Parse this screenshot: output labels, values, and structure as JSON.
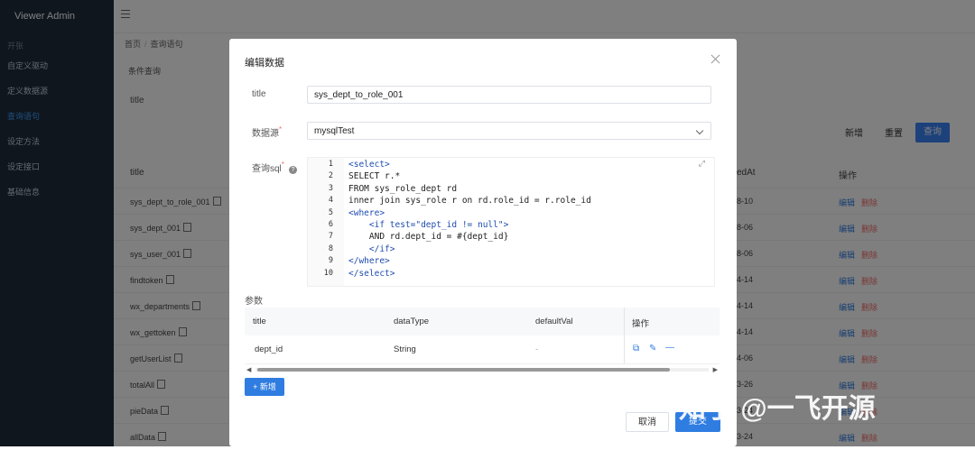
{
  "sidebar": {
    "brand": "Viewer Admin",
    "group_label": "开张",
    "items": [
      {
        "label": "自定义驱动"
      },
      {
        "label": "定义数据源"
      },
      {
        "label": "查询语句"
      },
      {
        "label": "设定方法"
      },
      {
        "label": "设定接口"
      },
      {
        "label": "基础信息"
      }
    ]
  },
  "breadcrumb": {
    "home": "首页",
    "sep": "/",
    "current": "查询语句"
  },
  "filter": {
    "section_label": "条件查询",
    "title_label": "title"
  },
  "toolbar": {
    "add": "新增",
    "reset": "重置",
    "query": "查询"
  },
  "table": {
    "headers": {
      "title": "title",
      "created": "edAt",
      "op": "操作"
    },
    "rows": [
      {
        "title": "sys_dept_to_role_001",
        "date": "8-10",
        "edit": "编辑",
        "del": "删除"
      },
      {
        "title": "sys_dept_001",
        "date": "8-06",
        "edit": "编辑",
        "del": "删除"
      },
      {
        "title": "sys_user_001",
        "date": "8-06",
        "edit": "编辑",
        "del": "删除"
      },
      {
        "title": "findtoken",
        "date": "4-14",
        "edit": "编辑",
        "del": "删除"
      },
      {
        "title": "wx_departments",
        "date": "4-14",
        "edit": "编辑",
        "del": "删除"
      },
      {
        "title": "wx_gettoken",
        "date": "4-14",
        "edit": "编辑",
        "del": "删除"
      },
      {
        "title": "getUserList",
        "date": "4-06",
        "edit": "编辑",
        "del": "删除"
      },
      {
        "title": "totalAll",
        "date": "3-26",
        "edit": "编辑",
        "del": "删除"
      },
      {
        "title": "pieData",
        "date": "3-24",
        "edit": "编辑",
        "del": "删除"
      },
      {
        "title": "allData",
        "date": "3-24",
        "edit": "编辑",
        "del": "删除"
      }
    ]
  },
  "modal": {
    "title": "编辑数据",
    "fields": {
      "title_label": "title",
      "title_value": "sys_dept_to_role_001",
      "datasource_label": "数据源",
      "datasource_value": "mysqlTest",
      "sql_label": "查询sql",
      "help": "?"
    },
    "sql_lines": [
      {
        "n": "1",
        "text": "<select>"
      },
      {
        "n": "2",
        "text": "SELECT r.*"
      },
      {
        "n": "3",
        "text": "FROM sys_role_dept rd"
      },
      {
        "n": "4",
        "text": "inner join sys_role r on rd.role_id = r.role_id"
      },
      {
        "n": "5",
        "text": "<where>"
      },
      {
        "n": "6",
        "text": "    <if test=\"dept_id != null\">"
      },
      {
        "n": "7",
        "text": "    AND rd.dept_id = #{dept_id}"
      },
      {
        "n": "8",
        "text": "    </if>"
      },
      {
        "n": "9",
        "text": "</where>"
      },
      {
        "n": "10",
        "text": "</select>"
      }
    ],
    "params": {
      "label": "参数",
      "headers": {
        "title": "title",
        "dataType": "dataType",
        "defaultVal": "defaultVal",
        "op": "操作"
      },
      "row": {
        "title": "dept_id",
        "dataType": "String",
        "defaultVal": "-"
      }
    },
    "add_button": "新增",
    "cancel": "取消",
    "submit": "提交"
  },
  "watermark": "知乎 @一飞开源"
}
